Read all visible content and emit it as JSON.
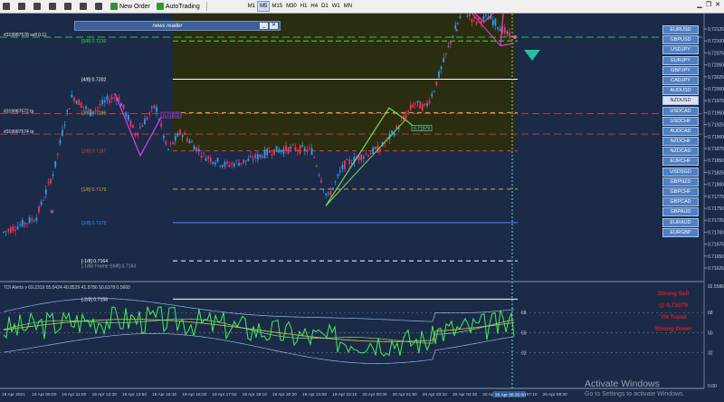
{
  "toolbar": {
    "items": [
      {
        "label": "",
        "icon": "arrow-cursor-icon"
      },
      {
        "label": "",
        "icon": "crosshair-icon"
      },
      {
        "label": "",
        "icon": "vertical-line-icon"
      },
      {
        "label": "",
        "icon": "horizontal-line-icon"
      },
      {
        "label": "",
        "icon": "trendline-icon"
      },
      {
        "label": "",
        "icon": "channel-icon"
      },
      {
        "label": "",
        "icon": "text-icon"
      },
      {
        "label": "New Order",
        "icon": "new-order-icon"
      },
      {
        "label": "AutoTrading",
        "icon": "autotrading-icon"
      }
    ],
    "timeframes": [
      "M1",
      "M5",
      "M15",
      "M30",
      "H1",
      "H4",
      "D1",
      "W1",
      "MN"
    ],
    "active_timeframe": "M5"
  },
  "news": {
    "title": "news reader",
    "minimize": "_",
    "close": "✕"
  },
  "chart": {
    "price_labels": [
      "0.72125",
      "0.72100",
      "0.72075",
      "0.72050",
      "0.72025",
      "0.72000",
      "0.71975",
      "0.71950",
      "0.71925",
      "0.71900",
      "0.71875",
      "0.71850",
      "0.71825",
      "0.71800",
      "0.71775",
      "0.71750",
      "0.71725",
      "0.71700",
      "0.71675",
      "0.71650",
      "0.71625"
    ],
    "murrey_levels": [
      {
        "label": "[8/8]  0.7217",
        "color": "#e04040"
      },
      {
        "label": "[5/8]  0.7210",
        "color": "#44dd44"
      },
      {
        "label": "[4/8]  0.7202",
        "color": "#ffffff"
      },
      {
        "label": "[3/8]  0.7195",
        "color": "#c8c84a"
      },
      {
        "label": "[2/8]  0.7187",
        "color": "#e04040"
      },
      {
        "label": "[1/8]  0.7179",
        "color": "#d9a640"
      },
      {
        "label": "[0/8]  0.7172",
        "color": "#3f8cff"
      },
      {
        "label": "[-1/8]  0.7164",
        "color": "#ffffff"
      },
      {
        "label": "[-2/8]  0.7156",
        "color": "#ffffff"
      },
      {
        "label": "[-1/8d Frame Shift]  0.7163",
        "color": "#9aa0aa"
      }
    ],
    "order_labels": [
      "#319987578 sell 0.11",
      "#319987572 tp",
      "#319987574 tp"
    ],
    "pattern_labels": [
      "0.71872",
      "0.71979",
      "0.72178"
    ],
    "time_labels": [
      "19 Apr 2021",
      "19 Apr 09:00",
      "19 Apr 11:00",
      "19 Apr 12:30",
      "19 Apr 13:50",
      "19 Apr 15:10",
      "19 Apr 16:30",
      "19 Apr 17:50",
      "19 Apr 19:10",
      "19 Apr 20:30",
      "19 Apr 21:50",
      "19 Apr 23:10",
      "20 Apr 00:30",
      "20 Apr 01:50",
      "20 Apr 03:10",
      "20 Apr 04:30",
      "20 Apr 05:50",
      "20 Apr 07:10",
      "20 Apr 08:30"
    ],
    "current_time_label": "20 Apr 08:35:00"
  },
  "indicator": {
    "title": "TDI Alerts  v 69.2319  55.0424  40.8529  41.8786  50.6378  0.5660",
    "scale_labels": [
      "92.5586",
      "68",
      "50",
      "32",
      "0.00"
    ],
    "levels": [
      "68",
      "50",
      "32"
    ]
  },
  "pairs": {
    "items": [
      "EURUSD",
      "GBPUSD",
      "USDJPY",
      "EURJPY",
      "GBPJPY",
      "CADJPY",
      "AUDUSD",
      "NZDUSD",
      "USDCAD",
      "USDCHF",
      "AUDCAD",
      "NZDCHF",
      "NZDCAD",
      "EURCHF",
      "USDSGD",
      "GBPNZD",
      "GBPCHF",
      "GBPCAD",
      "GBPAUD",
      "EURAUD",
      "EURGBP"
    ],
    "active": "NZDUSD"
  },
  "signal": {
    "line1": "Strong Sell",
    "line2": "@ 0.72079",
    "line3": "YN Trend",
    "line4": "Strong Down"
  },
  "activate": {
    "title": "Activate Windows",
    "subtitle": "Go to Settings to activate Windows."
  },
  "colors": {
    "background": "#1b2a47",
    "bull_candle": "#2f9cf5",
    "bear_candle": "#ff2f5a",
    "signal_red": "#e01b1b",
    "pattern_green": "#7fe84f",
    "pattern_magenta": "#e040e0"
  }
}
